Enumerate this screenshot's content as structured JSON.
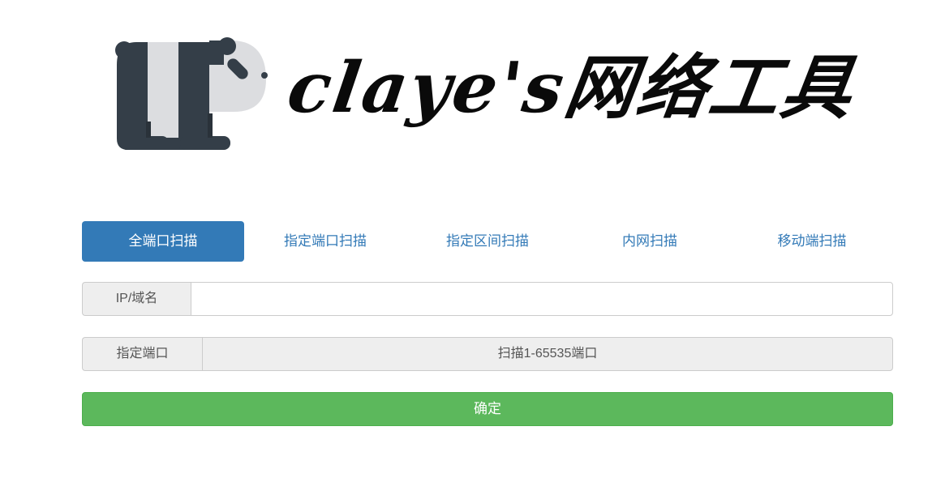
{
  "logo": {
    "text": "claye's网络工具",
    "mascot": "panda-icon",
    "colors": {
      "dark": "#343e48",
      "light": "#dcdde0"
    }
  },
  "tabs": [
    {
      "label": "全端口扫描",
      "active": true
    },
    {
      "label": "指定端口扫描",
      "active": false
    },
    {
      "label": "指定区间扫描",
      "active": false
    },
    {
      "label": "内网扫描",
      "active": false
    },
    {
      "label": "移动端扫描",
      "active": false
    }
  ],
  "form": {
    "ip_label": "IP/域名",
    "ip_value": "",
    "port_label": "指定端口",
    "port_value": "扫描1-65535端口"
  },
  "submit_label": "确定",
  "colors": {
    "primary": "#337ab7",
    "success": "#5cb85c",
    "addon_bg": "#eeeeee",
    "border": "#cccccc"
  }
}
